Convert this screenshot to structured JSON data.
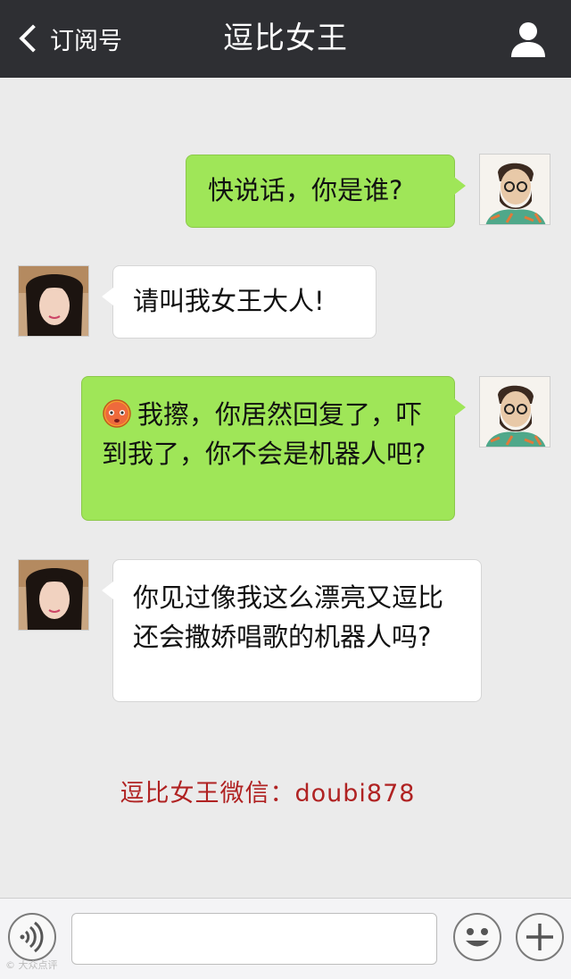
{
  "header": {
    "back_label": "订阅号",
    "title": "逗比女王"
  },
  "messages": [
    {
      "side": "out",
      "text": "快说话，你是谁?"
    },
    {
      "side": "in",
      "text": "请叫我女王大人!"
    },
    {
      "side": "out",
      "text": "我擦，你居然回复了，吓到我了，你不会是机器人吧?",
      "emoji": "blushing-face"
    },
    {
      "side": "in",
      "text": "你见过像我这么漂亮又逗比还会撒娇唱歌的机器人吗?"
    }
  ],
  "footer_note": "逗比女王微信：doubi878",
  "input": {
    "placeholder": ""
  },
  "credit": "© 大众点评",
  "colors": {
    "header_bg": "#2e2f33",
    "chat_bg": "#ebebeb",
    "out_bubble": "#9fe658",
    "in_bubble": "#ffffff",
    "note_text": "#b02222"
  }
}
